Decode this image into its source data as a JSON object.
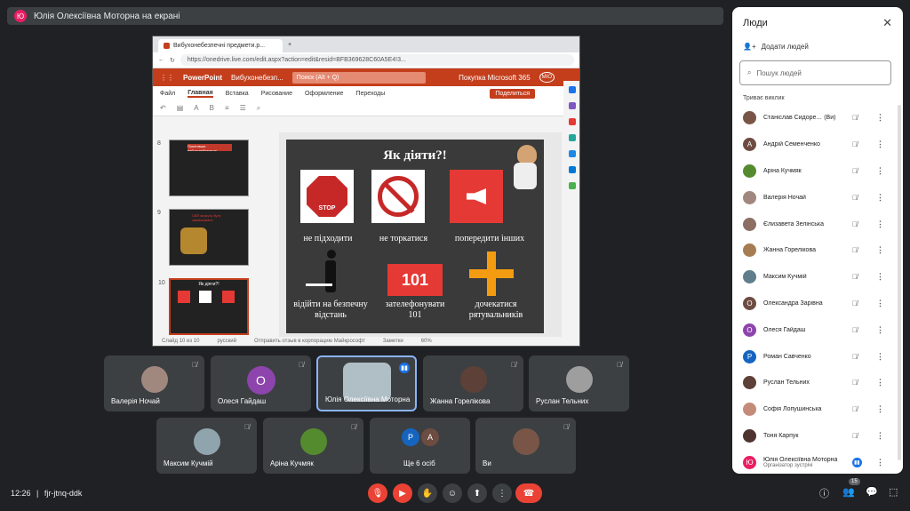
{
  "topbar": {
    "avatar_letter": "Ю",
    "title": "Юлія Олексіївна Моторна на екрані"
  },
  "browser": {
    "tab_title": "Вибухонебезпечні предмети.p...",
    "url": "https://onedrive.live.com/edit.aspx?action=edit&resid=BFB369628C60A5E4!3...",
    "app_name": "PowerPoint",
    "doc_name": "Вибухонебезп...",
    "search_placeholder": "Поиск (Alt + Q)",
    "promo": "Покупка Microsoft 365",
    "user_initials": "MIO",
    "menu": [
      "Файл",
      "Главная",
      "Вставка",
      "Рисование",
      "Оформление",
      "Переходы"
    ],
    "share_label": "Поделиться",
    "slide_numbers": [
      "8",
      "9",
      "10"
    ],
    "thumb8_title": "Помітивши вибухонебезпечні предмети:",
    "thumb9_title": "СВП можуть бути замасковані!",
    "thumb10_title": "Як діяти?!",
    "status": [
      "Слайд 10 из 10",
      "русский",
      "Отправить отзыв в корпорацию Майкрософт",
      "Заметки",
      "60%"
    ]
  },
  "slide": {
    "title": "Як діяти?!",
    "stop_text": "STOP",
    "label1": "не підходити",
    "label2": "не торкатися",
    "label3": "попередити інших",
    "label4": "відійти на безпечну відстань",
    "label5": "зателефонувати 101",
    "label6": "дочекатися рятувальників",
    "phone_number": "101"
  },
  "tiles": [
    {
      "name": "Валерія Ночай"
    },
    {
      "name": "Олеся Гайдаш",
      "letter": "О",
      "color": "#8e44ad"
    },
    {
      "name": "Юлія Олексіївна Моторна"
    },
    {
      "name": "Жанна Горелікова"
    },
    {
      "name": "Руслан Тельних"
    },
    {
      "name": "Максим Кучмій"
    },
    {
      "name": "Аріна Кучмяк"
    },
    {
      "name": "Ще 6 осіб",
      "letter1": "Р",
      "letter2": "А"
    },
    {
      "name": "Ви"
    }
  ],
  "people": {
    "title": "Люди",
    "add_label": "Додати людей",
    "search_placeholder": "Пошук людей",
    "section": "Триває виклик",
    "list": [
      {
        "name": "Станіслав Сидоре...",
        "you": "(Ви)",
        "letter": "",
        "color": "#795548"
      },
      {
        "name": "Андрій Семенченко",
        "letter": "А",
        "color": "#6d4c41"
      },
      {
        "name": "Аріна Кучмяк",
        "letter": "",
        "color": "#558b2f"
      },
      {
        "name": "Валерія Ночай",
        "letter": "",
        "color": "#a1887f"
      },
      {
        "name": "Єлизавета Зелінська",
        "letter": "",
        "color": "#8d6e63"
      },
      {
        "name": "Жанна Горелікова",
        "letter": "",
        "color": "#a67c52"
      },
      {
        "name": "Максим Кучмій",
        "letter": "",
        "color": "#607d8b"
      },
      {
        "name": "Олександра Зарівна",
        "letter": "О",
        "color": "#6d4c41"
      },
      {
        "name": "Олеся Гайдаш",
        "letter": "О",
        "color": "#8e44ad"
      },
      {
        "name": "Роман Савченко",
        "letter": "Р",
        "color": "#1565c0"
      },
      {
        "name": "Руслан Тельних",
        "letter": "",
        "color": "#5d4037"
      },
      {
        "name": "Софія Лопушинська",
        "letter": "",
        "color": "#c58b7a"
      },
      {
        "name": "Тоня Карпук",
        "letter": "",
        "color": "#4e342e"
      },
      {
        "name": "Юлія Олексіївна Моторна",
        "sub": "Організатор зустрічі",
        "letter": "Ю",
        "color": "#e91e63"
      }
    ]
  },
  "bottom": {
    "time": "12:26",
    "separator": "|",
    "meeting_code": "fjr-jtnq-ddk",
    "people_count": "15"
  }
}
